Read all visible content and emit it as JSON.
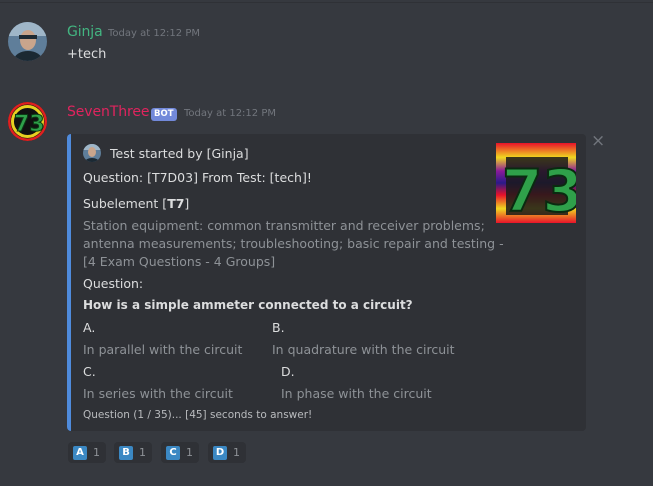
{
  "messages": [
    {
      "author": "Ginja",
      "author_color": "#43b581",
      "timestamp": "Today at 12:12 PM",
      "text": "+tech"
    },
    {
      "author": "SevenThree",
      "author_color": "#e0245e",
      "bot_tag": "BOT",
      "timestamp": "Today at 12:12 PM"
    }
  ],
  "embed": {
    "accent_color": "#4f8bdc",
    "author": "Test started by [Ginja]",
    "title": "Question: [T7D03] From Test: [tech]!",
    "subelement_label": "Subelement [",
    "subelement_code": "T7",
    "subelement_close": "]",
    "description": [
      "Station equipment: common transmitter and receiver problems;",
      "antenna measurements; troubleshooting; basic repair and testing -",
      "[4 Exam Questions - 4 Groups]"
    ],
    "question_label": "Question:",
    "question_text": "How is a simple ammeter connected to a circuit?",
    "answers": [
      {
        "letter": "A.",
        "text": "In parallel with the circuit"
      },
      {
        "letter": "B.",
        "text": "In quadrature with the circuit"
      },
      {
        "letter": "C.",
        "text": "In series with the circuit"
      },
      {
        "letter": "D.",
        "text": "In phase with the circuit"
      }
    ],
    "footer": "Question (1 / 35)... [45] seconds to answer!",
    "close_symbol": "×"
  },
  "reactions": [
    {
      "emoji": "A",
      "count": "1"
    },
    {
      "emoji": "B",
      "count": "1"
    },
    {
      "emoji": "C",
      "count": "1"
    },
    {
      "emoji": "D",
      "count": "1"
    }
  ]
}
